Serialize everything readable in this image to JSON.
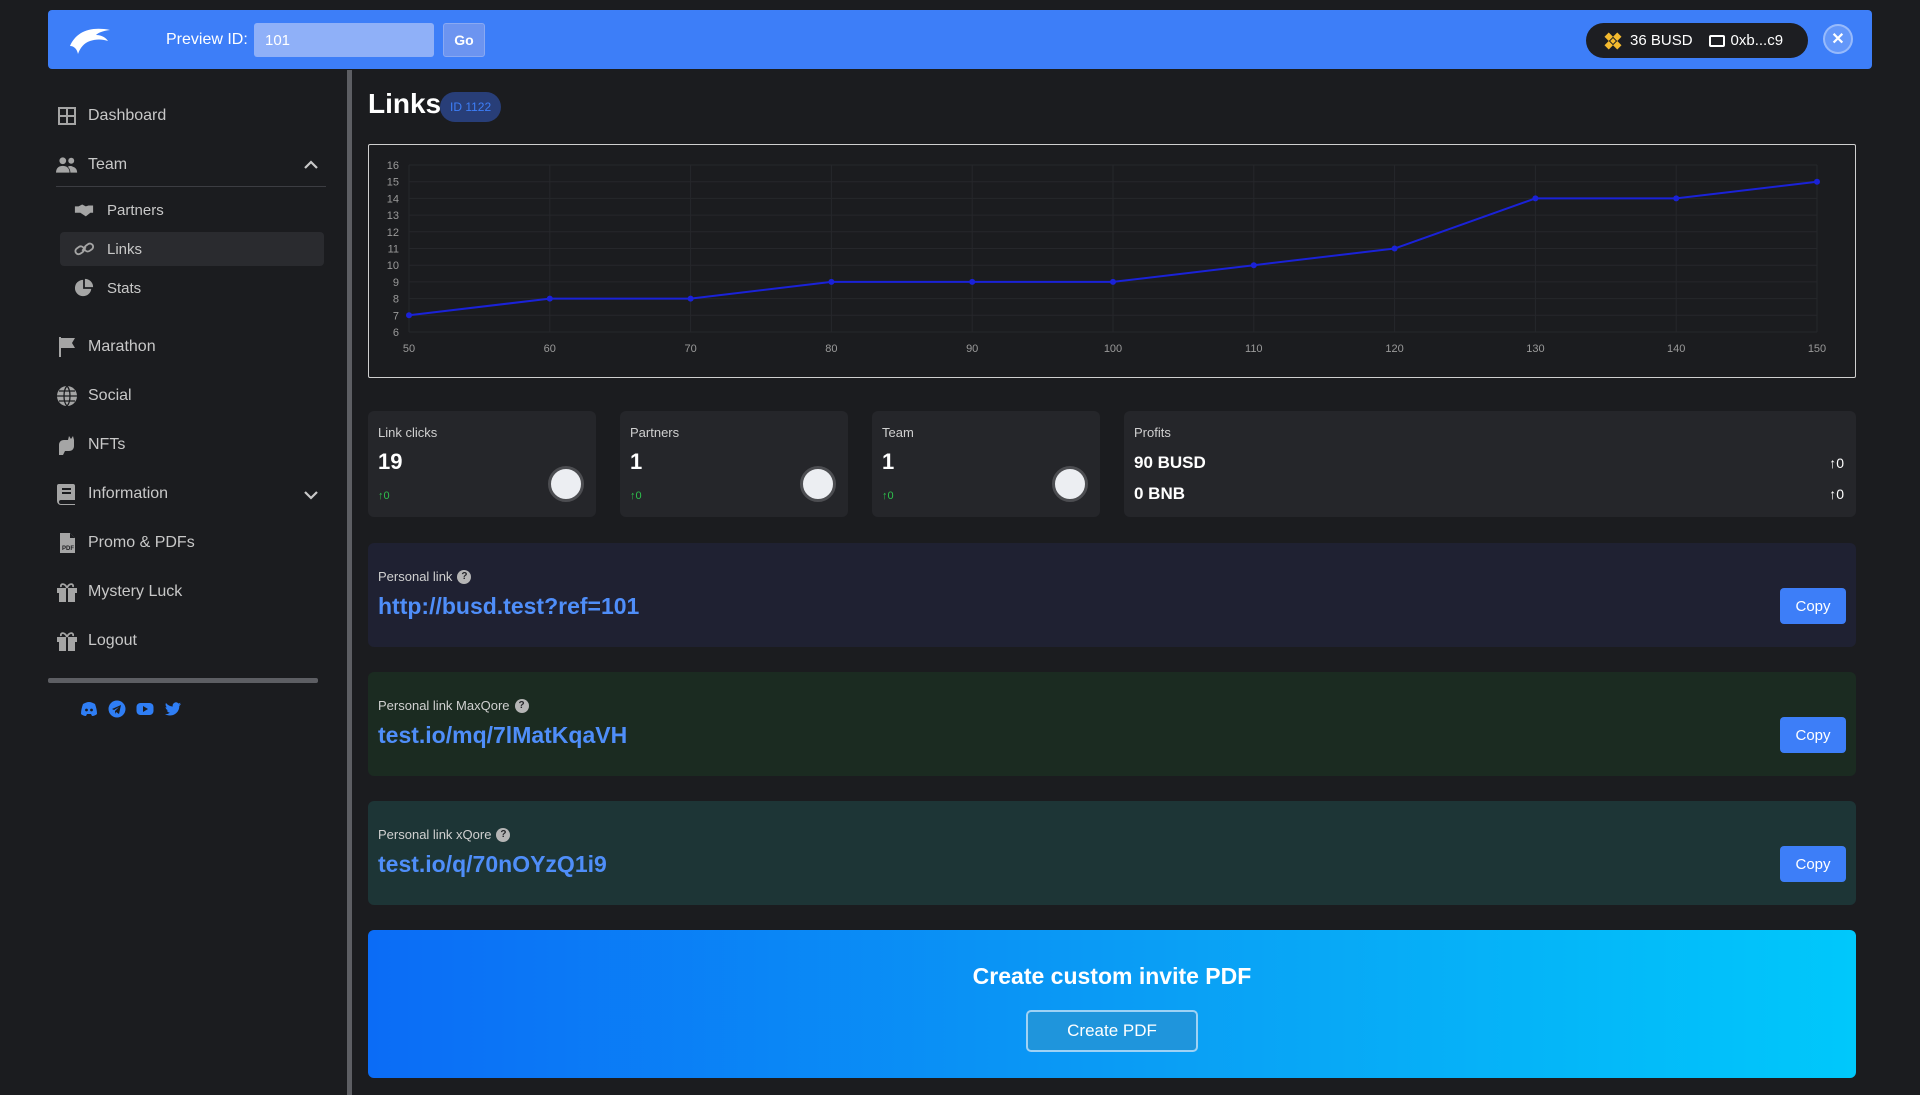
{
  "topbar": {
    "preview_label": "Preview ID:",
    "preview_value": "101",
    "go_label": "Go",
    "balance": "36 BUSD",
    "wallet_address": "0xb...c9",
    "close_label": "✕"
  },
  "sidebar": {
    "items": [
      {
        "label": "Dashboard",
        "icon": "dashboard-icon"
      },
      {
        "label": "Team",
        "icon": "users-icon"
      },
      {
        "label": "Marathon",
        "icon": "flag-icon"
      },
      {
        "label": "Social",
        "icon": "globe-icon"
      },
      {
        "label": "NFTs",
        "icon": "cat-icon"
      },
      {
        "label": "Information",
        "icon": "book-icon"
      },
      {
        "label": "Promo & PDFs",
        "icon": "pdf-icon"
      },
      {
        "label": "Mystery Luck",
        "icon": "gift-icon"
      },
      {
        "label": "Logout",
        "icon": "gift-icon"
      }
    ],
    "team_sub": [
      {
        "label": "Partners",
        "icon": "handshake-icon"
      },
      {
        "label": "Links",
        "icon": "link-icon"
      },
      {
        "label": "Stats",
        "icon": "pie-chart-icon"
      }
    ],
    "socials": [
      "discord-icon",
      "telegram-icon",
      "youtube-icon",
      "twitter-icon"
    ]
  },
  "page": {
    "title": "Links",
    "id_badge": "ID 1122"
  },
  "chart_data": {
    "type": "line",
    "x": [
      50,
      60,
      70,
      80,
      90,
      100,
      110,
      120,
      130,
      140,
      150
    ],
    "series": [
      {
        "values": [
          7,
          8,
          8,
          9,
          9,
          9,
          10,
          11,
          14,
          14,
          15
        ]
      }
    ],
    "xlim": [
      50,
      150
    ],
    "ylim": [
      6,
      16
    ],
    "x_ticks": [
      50,
      60,
      70,
      80,
      90,
      100,
      110,
      120,
      130,
      140,
      150
    ],
    "y_ticks": [
      6,
      7,
      8,
      9,
      10,
      11,
      12,
      13,
      14,
      15,
      16
    ],
    "grid": true,
    "line_color": "#1a22d8"
  },
  "stats": {
    "link_clicks": {
      "label": "Link clicks",
      "value": "19",
      "delta": "↑0"
    },
    "partners": {
      "label": "Partners",
      "value": "1",
      "delta": "↑0"
    },
    "team": {
      "label": "Team",
      "value": "1",
      "delta": "↑0"
    },
    "profits": {
      "label": "Profits",
      "busd": "90 BUSD",
      "busd_delta": "↑0",
      "bnb": "0 BNB",
      "bnb_delta": "↑0"
    }
  },
  "links": [
    {
      "label": "Personal link",
      "url": "http://busd.test?ref=101",
      "copy": "Copy",
      "bg": "#1f2132"
    },
    {
      "label": "Personal link MaxQore",
      "url": "test.io/mq/7lMatKqaVH",
      "copy": "Copy",
      "bg": "#1b2b21"
    },
    {
      "label": "Personal link xQore",
      "url": "test.io/q/70nOYzQ1i9",
      "copy": "Copy",
      "bg": "#1d3536"
    }
  ],
  "pdf": {
    "title": "Create custom invite PDF",
    "button": "Create PDF"
  }
}
